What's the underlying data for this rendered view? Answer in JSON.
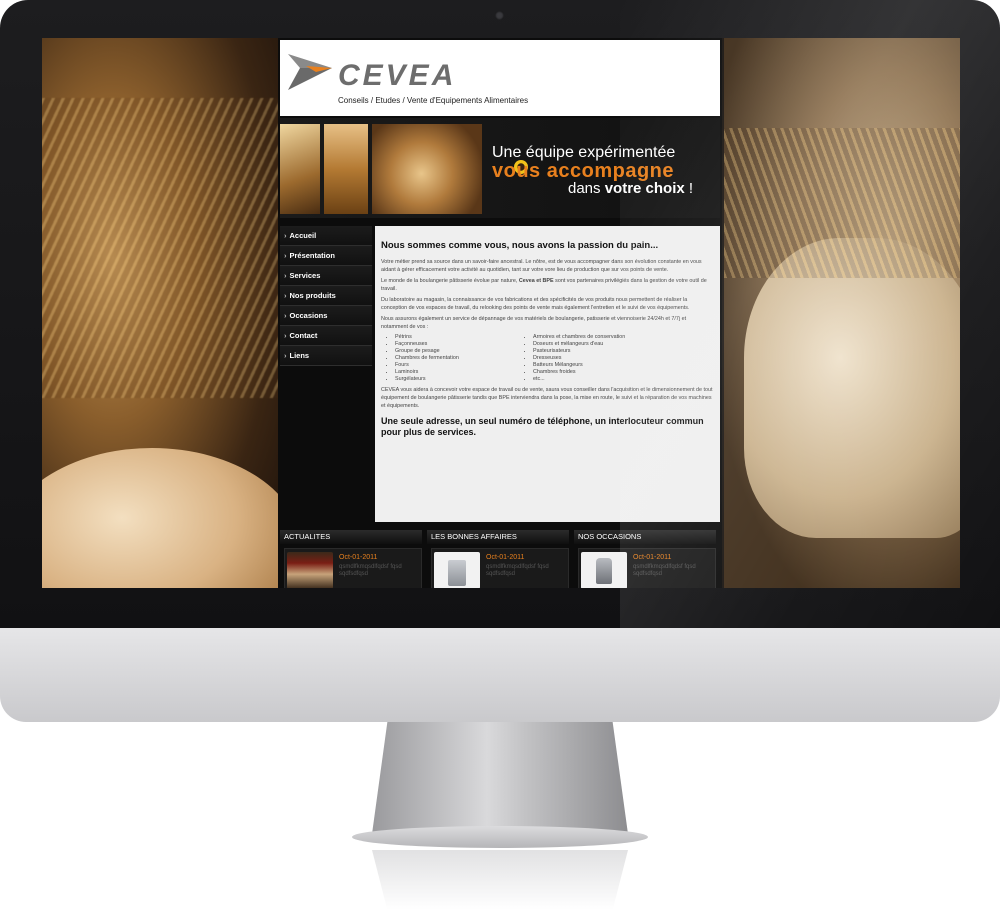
{
  "site": {
    "logo_text": "CEVEA",
    "tagline": "Conseils / Etudes / Vente d'Equipements Alimentaires"
  },
  "banner": {
    "line1": "Une équipe expérimentée",
    "line2": "vous accompagne",
    "line3_prefix": "dans ",
    "line3_bold": "votre choix",
    "line3_suffix": " !"
  },
  "nav": {
    "items": [
      {
        "label": "Accueil"
      },
      {
        "label": "Présentation"
      },
      {
        "label": "Services"
      },
      {
        "label": "Nos produits"
      },
      {
        "label": "Occasions"
      },
      {
        "label": "Contact"
      },
      {
        "label": "Liens"
      }
    ]
  },
  "content": {
    "heading": "Nous sommes comme vous, nous avons la passion du pain...",
    "para1": "Votre métier prend sa source dans un savoir-faire ancestral. Le nôtre, est de vous accompagner dans son évolution constante en vous aidant à gérer efficacement votre activité au quotidien, tant sur votre vore lieu de production que sur vos points de vente.",
    "para2_a": "Le monde de la boulangerie pâtisserie évolue par nature, ",
    "para2_bold": "Cevea et BPE",
    "para2_b": " sont vos partenaires privilégiés dans la gestion de votre outil de travail.",
    "para3": "Du laboratoire au magasin, la connaissance de vos fabrications et des spécificités de vos produits nous permettent de réaliser la conception de vos espaces de travail, du relooking des points de vente mais également l'entretien et le suivi de vos équipements.",
    "para4": "Nous assurons également un service de dépannage de vos matériels de boulangerie, patisserie et viennoiserie 24/24h et 7/7j et notamment de vos :",
    "list_left": [
      "Pétrins",
      "Façonneuses",
      "Groupe de pesage",
      "Chambres de fermentation",
      "Fours",
      "Laminoirs",
      "Surgélateurs"
    ],
    "list_right": [
      "Armoires et chambres de conservation",
      "Doseurs et mélangeurs d'eau",
      "Pasteurisateurs",
      "Dresseuses",
      "Batteurs Mélangeurs",
      "Chambres froides",
      "etc..."
    ],
    "para5": "CEVEA vous aidera à concevoir votre espace de travail ou de vente, saura vous conseiller dans l'acquisition et le dimensionnement de tout équipement de boulangerie pâtisserie tandis que BPE interviendra dans la pose, la mise en route, le suivi et la réparation de vos machines et équipements.",
    "closing": "Une seule adresse, un seul numéro de téléphone, un interlocuteur commun pour plus de services."
  },
  "bottom": {
    "columns": [
      {
        "title": "ACTUALITES",
        "date": "Oct-01-2011",
        "text": "qsmdlfkmqsdlfqdsf fqsd sqdfsdfqsd"
      },
      {
        "title": "LES BONNES AFFAIRES",
        "date": "Oct-01-2011",
        "text": "qsmdlfkmqsdlfqdsf fqsd sqdfsdfqsd"
      },
      {
        "title": "NOS OCCASIONS",
        "date": "Oct-01-2011",
        "text": "qsmdlfkmqsdlfqdsf fqsd sqdfsdfqsd"
      }
    ]
  },
  "colors": {
    "accent_orange": "#e8801e",
    "nav_bg": "#111111",
    "content_bg": "#efefef"
  }
}
